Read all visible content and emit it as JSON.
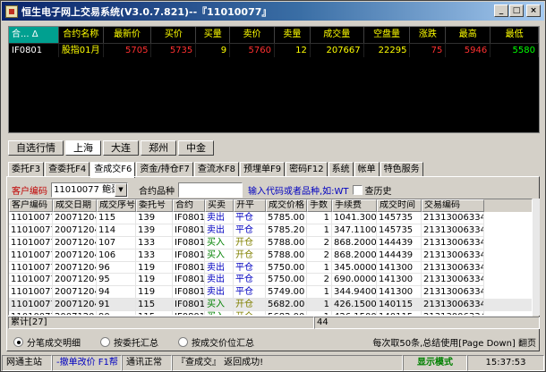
{
  "window": {
    "title": "恒生电子网上交易系统(V3.0.7.821)--『11010077』",
    "minimize": "_",
    "maximize": "□",
    "close": "×"
  },
  "quote": {
    "headers": [
      "合... Δ",
      "合约名称",
      "最新价",
      "买价",
      "买量",
      "卖价",
      "卖量",
      "成交量",
      "空盘量",
      "涨跌",
      "最高",
      "最低"
    ],
    "row": {
      "icon": "□",
      "code": "IF0801",
      "name": "股指01月",
      "last": "5705",
      "bid": "5735",
      "bid_qty": "9",
      "ask": "5760",
      "ask_qty": "12",
      "volume": "207667",
      "open_interest": "22295",
      "change": "75",
      "high": "5946",
      "low": "5580"
    }
  },
  "market_tabs": [
    {
      "label": "自选行情",
      "active": false
    },
    {
      "label": "上海",
      "active": true
    },
    {
      "label": "大连",
      "active": false
    },
    {
      "label": "郑州",
      "active": false
    },
    {
      "label": "中金",
      "active": false
    }
  ],
  "function_tabs": [
    {
      "label": "委托F3",
      "active": false
    },
    {
      "label": "查委托F4",
      "active": false
    },
    {
      "label": "查成交F6",
      "active": true
    },
    {
      "label": "资金/持仓F7",
      "active": false
    },
    {
      "label": "查流水F8",
      "active": false
    },
    {
      "label": "预埋单F9",
      "active": false
    },
    {
      "label": "密码F12",
      "active": false
    },
    {
      "label": "系统",
      "active": false
    },
    {
      "label": "帐单",
      "active": false
    },
    {
      "label": "特色服务",
      "active": false
    }
  ],
  "filter": {
    "customer_label": "客户编码",
    "customer_value": "11010077 鲍蛋",
    "contract_label": "合约品种",
    "contract_value": "",
    "hint": "输入代码或者品种,如:WT",
    "history_label": "查历史"
  },
  "trades": {
    "columns": [
      "客户编码",
      "成交日期",
      "成交序号",
      "委托号",
      "合约",
      "买卖",
      "开平",
      "成交价格",
      "手数",
      "手续费",
      "成交时间",
      "交易编码"
    ],
    "rows": [
      [
        "11010077",
        "20071204",
        "115",
        "139",
        "IF0801",
        "卖出",
        "平仓",
        "5785.00",
        "1",
        "1041.3000",
        "145735",
        "213130063342"
      ],
      [
        "11010077",
        "20071204",
        "114",
        "139",
        "IF0801",
        "卖出",
        "平仓",
        "5785.20",
        "1",
        "347.1100",
        "145735",
        "213130063342"
      ],
      [
        "11010077",
        "20071204",
        "107",
        "133",
        "IF0801",
        "买入",
        "开仓",
        "5788.00",
        "2",
        "868.2000",
        "144439",
        "213130063342"
      ],
      [
        "11010077",
        "20071204",
        "106",
        "133",
        "IF0801",
        "买入",
        "开仓",
        "5788.00",
        "2",
        "868.2000",
        "144439",
        "213130063342"
      ],
      [
        "11010077",
        "20071204",
        "96",
        "119",
        "IF0801",
        "卖出",
        "平仓",
        "5750.00",
        "1",
        "345.0000",
        "141300",
        "213130063342"
      ],
      [
        "11010077",
        "20071204",
        "95",
        "119",
        "IF0801",
        "卖出",
        "平仓",
        "5750.00",
        "2",
        "690.0000",
        "141300",
        "213130063342"
      ],
      [
        "11010077",
        "20071204",
        "94",
        "119",
        "IF0801",
        "卖出",
        "平仓",
        "5749.00",
        "1",
        "344.9400",
        "141300",
        "213130063342"
      ],
      [
        "11010077",
        "20071204",
        "91",
        "115",
        "IF0801",
        "买入",
        "开仓",
        "5682.00",
        "1",
        "426.1500",
        "140115",
        "213130063342"
      ],
      [
        "11010077",
        "20071204",
        "90",
        "115",
        "IF0801",
        "买入",
        "开仓",
        "5682.00",
        "1",
        "426.1500",
        "140115",
        "213130063342"
      ]
    ],
    "selected_row": 7
  },
  "summary": {
    "count": "累计[27]",
    "qty": "44"
  },
  "options": [
    {
      "label": "分笔成交明细",
      "checked": true
    },
    {
      "label": "按委托汇总",
      "checked": false
    },
    {
      "label": "按成交价位汇总",
      "checked": false
    }
  ],
  "paging_hint": "每次取50条,总结使用[Page Down] 翻页",
  "status": {
    "station": "网通主站",
    "shortcut": "-撤单改价 F1帮",
    "connection": "通讯正常",
    "message": "『查成交』 返回成功!",
    "mode": "显示模式",
    "time": "15:37:53"
  },
  "colors": {
    "titlebar_start": "#0a246a",
    "quote_bg": "#000000",
    "price_up": "#ff3030",
    "buy": "#008000",
    "sell": "#0000c0",
    "status_mode": "#008000"
  }
}
